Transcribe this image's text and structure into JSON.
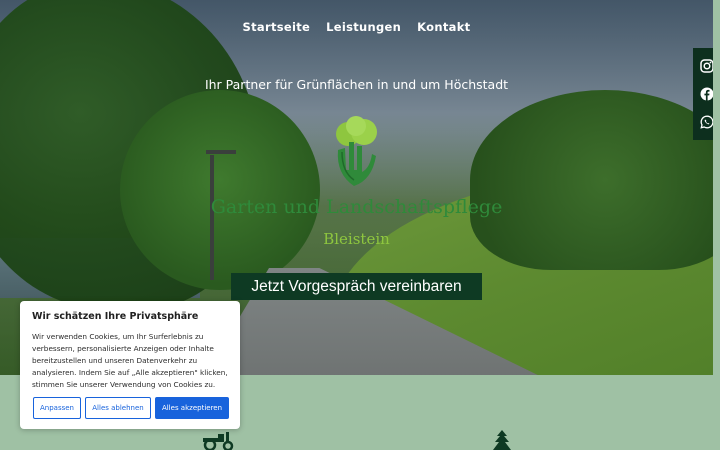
{
  "nav": {
    "items": [
      {
        "label": "Startseite"
      },
      {
        "label": "Leistungen"
      },
      {
        "label": "Kontakt"
      }
    ]
  },
  "hero": {
    "tagline": "Ihr Partner für Grünflächen in und um Höchstadt",
    "brand_line1": "Garten und Landschaftspflege",
    "brand_line2": "Bleistein",
    "cta_label": "Jetzt Vorgespräch vereinbaren"
  },
  "social": {
    "items": [
      {
        "icon": "instagram-icon"
      },
      {
        "icon": "facebook-icon"
      },
      {
        "icon": "whatsapp-icon"
      }
    ]
  },
  "cookie_banner": {
    "title": "Wir schätzen Ihre Privatsphäre",
    "text": "Wir verwenden Cookies, um Ihr Surferlebnis zu verbessern, personalisierte Anzeigen oder Inhalte bereitzustellen und unseren Datenverkehr zu analysieren. Indem Sie auf „Alle akzeptieren\" klicken, stimmen Sie unserer Verwendung von Cookies zu.",
    "customize_label": "Anpassen",
    "reject_label": "Alles ablehnen",
    "accept_label": "Alles akzeptieren"
  },
  "colors": {
    "accent_blue": "#1863dc",
    "brand_dark_green": "#0e3a23",
    "brand_green": "#2f8a3a",
    "brand_light_green": "#8ec63f",
    "section_bg": "#9fc1a4"
  }
}
